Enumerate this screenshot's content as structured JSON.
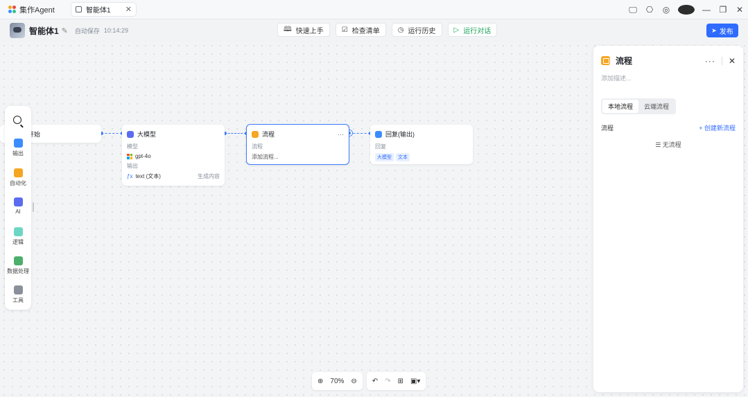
{
  "app": {
    "title": "集作Agent"
  },
  "tab": {
    "label": "智能体1",
    "close": "✕"
  },
  "window": {
    "icons": [
      "monitor-icon",
      "gift-icon",
      "help-icon",
      "user-avatar",
      "minimize-icon",
      "restore-icon",
      "close-icon"
    ]
  },
  "agent": {
    "name": "智能体1",
    "save_status": "自动保存",
    "save_time": "10:14:29"
  },
  "toolbar": {
    "quick_start": "快速上手",
    "check_list": "检查清单",
    "run_history": "运行历史",
    "run_dialog": "运行对话",
    "publish": "发布"
  },
  "nodes": {
    "start": {
      "title": "开始"
    },
    "llm": {
      "title": "大模型",
      "model_label": "模型",
      "model_value": "gpt-4o",
      "output_label": "输出",
      "output_var": "text (文本)",
      "output_desc": "生成内容"
    },
    "flow": {
      "title": "流程",
      "label": "流程",
      "desc": "添加流程..."
    },
    "reply": {
      "title": "回复(输出)",
      "label": "回复",
      "tag1": "大模型",
      "tag2": "文本"
    }
  },
  "palette": {
    "search": "search-icon",
    "items": [
      {
        "label": "输出"
      },
      {
        "label": "自动化"
      },
      {
        "label": "AI"
      },
      {
        "label": "逻辑"
      },
      {
        "label": "数据处理"
      },
      {
        "label": "工具"
      }
    ]
  },
  "panel": {
    "title": "流程",
    "more": "···",
    "description": "添加描述...",
    "segments": [
      "本地流程",
      "云端流程"
    ],
    "flow_label": "流程",
    "create": "+ 创建新流程",
    "empty": "无流程"
  },
  "zoom": {
    "level": "70%"
  },
  "colors": {
    "accent": "#2f6bff",
    "run": "#1aa35b",
    "flow_icon": "#f5a623"
  }
}
